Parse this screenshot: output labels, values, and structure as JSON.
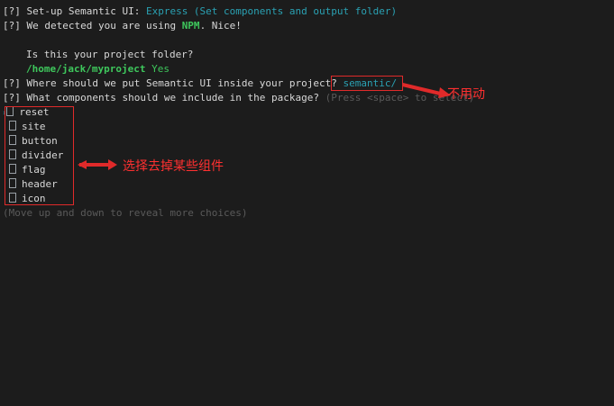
{
  "terminal": {
    "line1": {
      "prefix": "[?]",
      "text": " Set-up Semantic UI:",
      "answer": "Express (Set components and output folder)"
    },
    "line2": {
      "prefix": "[?]",
      "text": " We detected you are using",
      "highlight": "NPM",
      "suffix": ". Nice!"
    },
    "line3": {
      "text": "Is this your project folder?"
    },
    "line4": {
      "path": "/home/jack/myproject",
      "answer": "Yes"
    },
    "line5": {
      "prefix": "[?]",
      "text": " Where should we put Semantic UI inside your project?",
      "answer": "semantic/"
    },
    "line6": {
      "prefix": "[?]",
      "text": " What components should we include in the package?",
      "hint": "(Press <space> to select)"
    },
    "components": [
      "reset",
      "site",
      "button",
      "divider",
      "flag",
      "header",
      "icon"
    ],
    "more_hint": "(Move up and down to reveal more choices)"
  },
  "annotations": {
    "no_change": "不用动",
    "deselect": "选择去掉某些组件"
  },
  "colors": {
    "background": "#1c1c1c",
    "answer_cyan": "#2aa1b3",
    "highlight_green": "#3ec75c",
    "annotation_red": "#e02a2a"
  }
}
